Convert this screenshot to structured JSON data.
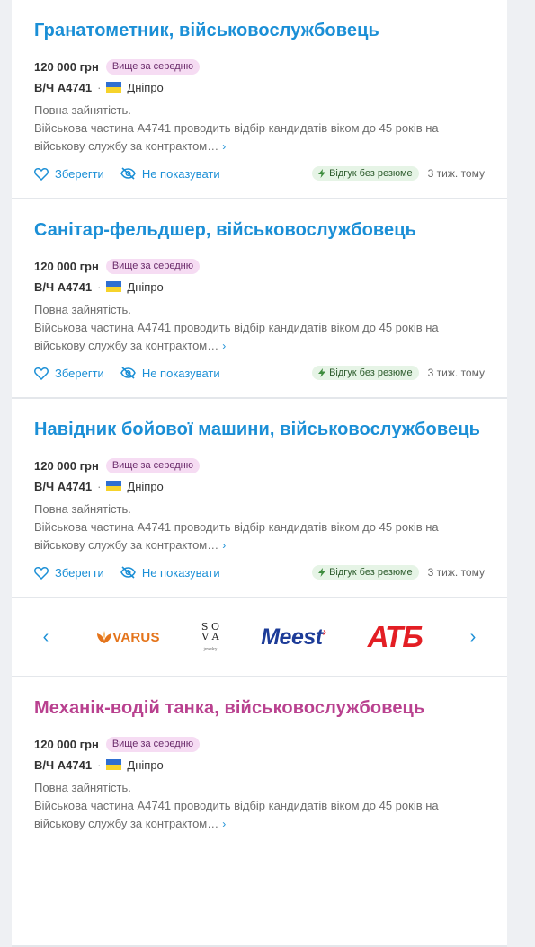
{
  "jobs": [
    {
      "title": "Гранатометник, військовослужбовець",
      "salary": "120 000 грн",
      "salary_badge": "Вище за середню",
      "company": "В/Ч А4741",
      "city": "Дніпро",
      "employment": "Повна зайнятість.",
      "desc_line1": "Військова частина А4741 проводить відбір кандидатів віком до 45 років на",
      "desc_line2": "військову службу за контрактом…",
      "save_label": "Зберегти",
      "hide_label": "Не показувати",
      "quick_label": "Відгук без резюме",
      "age": "3 тиж. тому"
    },
    {
      "title": "Санітар-фельдшер, військовослужбовець",
      "salary": "120 000 грн",
      "salary_badge": "Вище за середню",
      "company": "В/Ч А4741",
      "city": "Дніпро",
      "employment": "Повна зайнятість.",
      "desc_line1": "Військова частина А4741 проводить відбір кандидатів віком до 45 років на",
      "desc_line2": "військову службу за контрактом…",
      "save_label": "Зберегти",
      "hide_label": "Не показувати",
      "quick_label": "Відгук без резюме",
      "age": "3 тиж. тому"
    },
    {
      "title": "Навідник бойової машини, військовослужбовець",
      "salary": "120 000 грн",
      "salary_badge": "Вище за середню",
      "company": "В/Ч А4741",
      "city": "Дніпро",
      "employment": "Повна зайнятість.",
      "desc_line1": "Військова частина А4741 проводить відбір кандидатів віком до 45 років на",
      "desc_line2": "військову службу за контрактом…",
      "save_label": "Зберегти",
      "hide_label": "Не показувати",
      "quick_label": "Відгук без резюме",
      "age": "3 тиж. тому"
    },
    {
      "title": "Механік-водій танка, військовослужбовець",
      "salary": "120 000 грн",
      "salary_badge": "Вище за середню",
      "company": "В/Ч А4741",
      "city": "Дніпро",
      "employment": "Повна зайнятість.",
      "desc_line1": "Військова частина А4741 проводить відбір кандидатів віком до 45 років на",
      "desc_line2": "військову службу за контрактом…"
    }
  ],
  "brands": {
    "logos": [
      "VARUS",
      "SOVA",
      "Meest",
      "АТБ"
    ],
    "varus_color": "#e4741b",
    "meest_color": "#1d3c98",
    "atb_color": "#e31e24"
  },
  "colors": {
    "link": "#1b8fd6",
    "visited_title": "#b9418f",
    "badge_bg": "#f6dcf3",
    "quick_bg": "#e6f4e6"
  },
  "icons": {
    "separator": "·",
    "more": "›",
    "prev": "‹",
    "next": "›"
  }
}
